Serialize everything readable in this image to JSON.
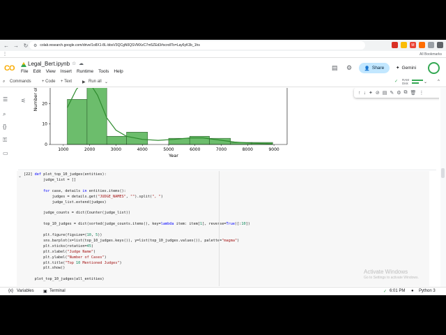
{
  "browser": {
    "url": "colab.research.google.com/drive/1o8X1-8L-bbsV3QCgN0QSVMXzC7m5ZEd3#scrollTo=Lay6yK3b_1hs",
    "bookmarks_label": "All Bookmarks"
  },
  "colab": {
    "notebook_title": "Legal_Bert.ipynb",
    "menu": [
      "File",
      "Edit",
      "View",
      "Insert",
      "Runtime",
      "Tools",
      "Help"
    ],
    "share_label": "Share",
    "gemini_label": "Gemini"
  },
  "toolbar": {
    "commands": "Commands",
    "add_code": "+ Code",
    "add_text": "+ Text",
    "run_all": "Run all",
    "ram_label": "RAM",
    "disk_label": "Disk"
  },
  "chart_data": {
    "type": "bar",
    "xlabel": "Year",
    "ylabel": "Number of",
    "x_ticks": [
      "1000",
      "2000",
      "3000",
      "4000",
      "5000",
      "6000",
      "7000",
      "8000",
      "9000"
    ],
    "y_ticks": [
      "0",
      "10",
      "20"
    ],
    "bins": [
      {
        "start": 1150,
        "end": 1900,
        "value": 22
      },
      {
        "start": 1900,
        "end": 2650,
        "value": 31
      },
      {
        "start": 2650,
        "end": 3400,
        "value": 4
      },
      {
        "start": 3400,
        "end": 4200,
        "value": 6
      },
      {
        "start": 4200,
        "end": 5000,
        "value": 0
      },
      {
        "start": 5000,
        "end": 5800,
        "value": 3
      },
      {
        "start": 5800,
        "end": 6550,
        "value": 4
      },
      {
        "start": 6550,
        "end": 7350,
        "value": 3
      },
      {
        "start": 7350,
        "end": 8150,
        "value": 1
      },
      {
        "start": 8150,
        "end": 8950,
        "value": 1
      }
    ],
    "kde": [
      [
        1150,
        18
      ],
      [
        1500,
        27
      ],
      [
        1900,
        32
      ],
      [
        2300,
        24
      ],
      [
        2650,
        13
      ],
      [
        3000,
        7
      ],
      [
        3400,
        4
      ],
      [
        4000,
        2.5
      ],
      [
        4600,
        2
      ],
      [
        5200,
        2.5
      ],
      [
        5800,
        3.2
      ],
      [
        6300,
        3.2
      ],
      [
        6900,
        2.2
      ],
      [
        7500,
        1.2
      ],
      [
        8200,
        0.6
      ],
      [
        8950,
        0.3
      ]
    ],
    "xlim": [
      500,
      9500
    ],
    "ylim": [
      0,
      31
    ],
    "bar_color": "#6cbd6c",
    "line_color": "#2e8b2e"
  },
  "cell": {
    "exec_count": "[22]",
    "code_lines": [
      "def plot_top_10_judges(entities):",
      "    judge_list = []",
      "",
      "    for case, details in entities.items():",
      "        judges = details.get(\"JUDGE_NAMES\", \"\").split(\", \")",
      "        judge_list.extend(judges)",
      "",
      "    judge_counts = dict(Counter(judge_list))",
      "",
      "    top_10_judges = dict(sorted(judge_counts.items(), key=lambda item: item[1], reverse=True)[:10])",
      "",
      "    plt.figure(figsize=(10, 5))",
      "    sns.barplot(x=list(top_10_judges.keys()), y=list(top_10_judges.values()), palette=\"magma\")",
      "    plt.xticks(rotation=45)",
      "    plt.xlabel(\"Judge Name\")",
      "    plt.ylabel(\"Number of Cases\")",
      "    plt.title(\"Top 10 Mentioned Judges\")",
      "    plt.show()",
      "",
      "plot_top_10_judges(all_entities)"
    ]
  },
  "watermark": {
    "line1": "Activate Windows",
    "line2": "Go to Settings to activate Windows."
  },
  "status": {
    "variables": "Variables",
    "terminal": "Terminal",
    "time": "6:01 PM",
    "runtime": "Python 3"
  }
}
